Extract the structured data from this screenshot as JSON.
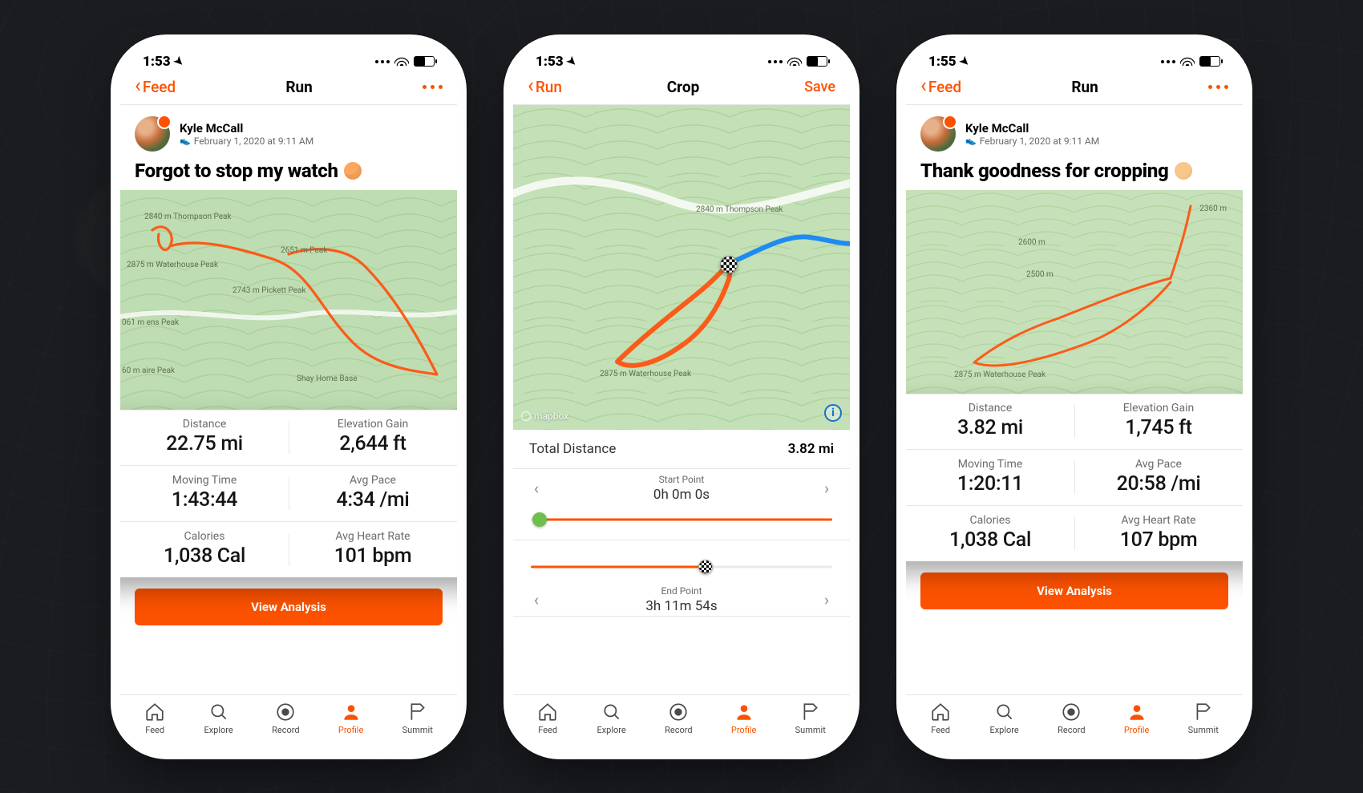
{
  "statusbar": {
    "time_a": "1:53",
    "time_b": "1:53",
    "time_c": "1:55"
  },
  "nav": {
    "feed": "Feed",
    "run": "Run",
    "crop": "Crop",
    "save": "Save"
  },
  "user": {
    "name": "Kyle McCall",
    "date": "February 1, 2020 at 9:11 AM"
  },
  "activity_a": {
    "title": "Forgot to stop my watch "
  },
  "activity_c": {
    "title": "Thank goodness for cropping "
  },
  "stats_a": {
    "distance_lab": "Distance",
    "distance": "22.75 mi",
    "elev_lab": "Elevation Gain",
    "elev": "2,644 ft",
    "time_lab": "Moving Time",
    "time": "1:43:44",
    "pace_lab": "Avg Pace",
    "pace": "4:34 /mi",
    "cal_lab": "Calories",
    "cal": "1,038 Cal",
    "hr_lab": "Avg Heart Rate",
    "hr": "101 bpm"
  },
  "stats_c": {
    "distance_lab": "Distance",
    "distance": "3.82 mi",
    "elev_lab": "Elevation Gain",
    "elev": "1,745 ft",
    "time_lab": "Moving Time",
    "time": "1:20:11",
    "pace_lab": "Avg Pace",
    "pace": "20:58 /mi",
    "cal_lab": "Calories",
    "cal": "1,038 Cal",
    "hr_lab": "Avg Heart Rate",
    "hr": "107 bpm"
  },
  "crop": {
    "total_label": "Total Distance",
    "total_value": "3.82 mi",
    "start_label": "Start Point",
    "start_value": "0h 0m 0s",
    "end_label": "End Point",
    "end_value": "3h 11m 54s",
    "mapbox": "mapbox"
  },
  "cta": {
    "view": "View Analysis"
  },
  "tabs": {
    "feed": "Feed",
    "explore": "Explore",
    "record": "Record",
    "profile": "Profile",
    "summit": "Summit"
  },
  "map_labels": {
    "thompson": "2840 m\nThompson\nPeak",
    "waterhouse": "2875 m\nWaterhouse\nPeak",
    "pickett": "2743 m\nPickett Peak",
    "p2651": "2651 m\nPeak",
    "stevens": "061 m\nens Peak",
    "aire": "60 m\naire Peak",
    "home": "Shay\nHome Base",
    "c2360": "2360 m",
    "c2500": "2500 m",
    "c2600": "2600 m"
  }
}
